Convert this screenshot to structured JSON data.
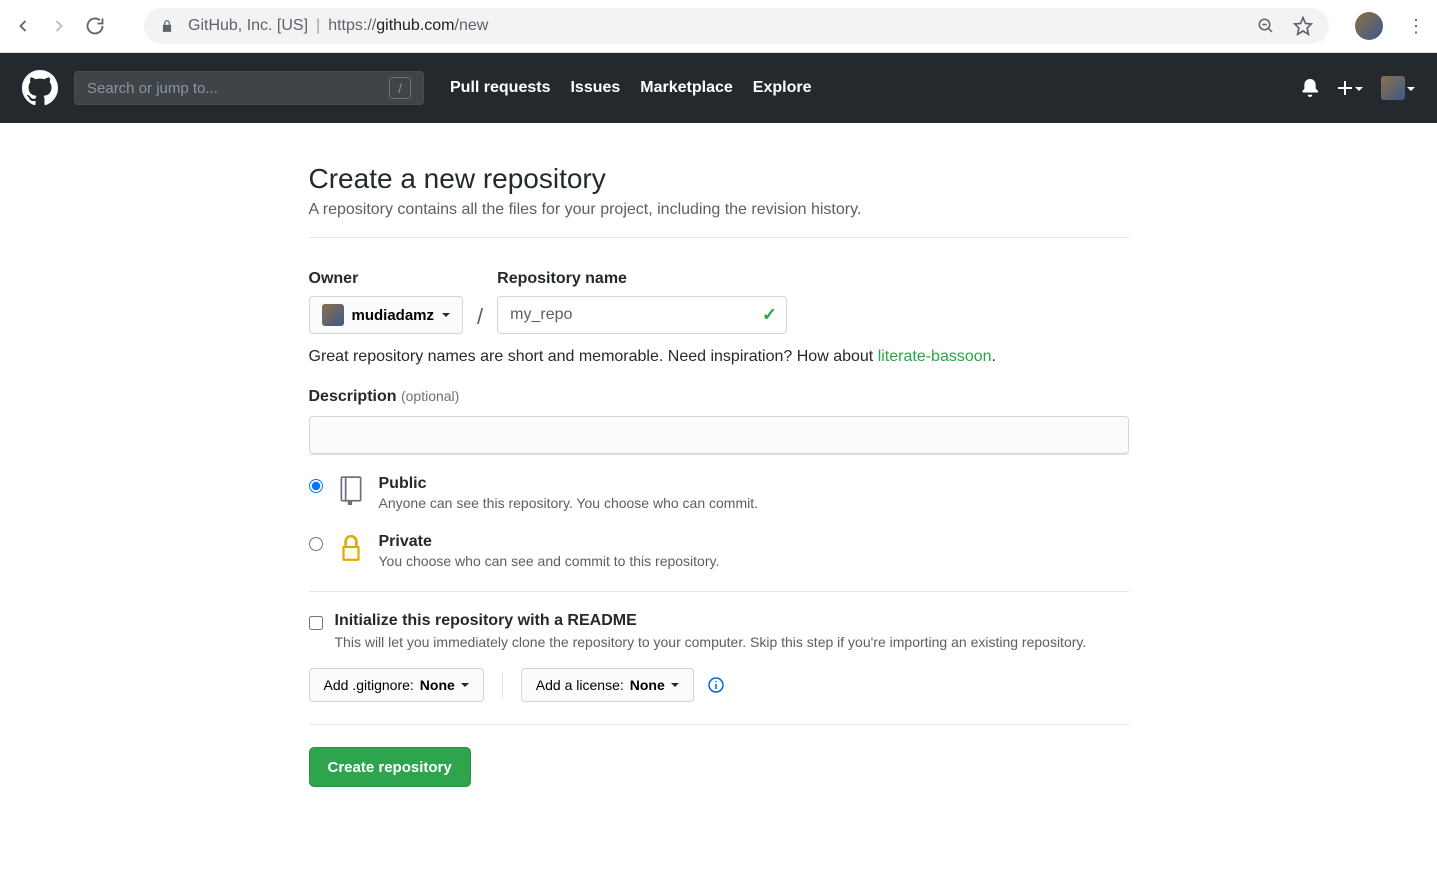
{
  "browser": {
    "identity": "GitHub, Inc. [US]",
    "url_protocol": "https://",
    "url_domain": "github.com",
    "url_path": "/new"
  },
  "gh_header": {
    "search_placeholder": "Search or jump to...",
    "slash_key": "/",
    "nav": [
      "Pull requests",
      "Issues",
      "Marketplace",
      "Explore"
    ]
  },
  "page": {
    "title": "Create a new repository",
    "subtitle": "A repository contains all the files for your project, including the revision history.",
    "owner_label": "Owner",
    "owner_value": "mudiadamz",
    "reponame_label": "Repository name",
    "reponame_value": "my_repo",
    "hint_prefix": "Great repository names are short and memorable. Need inspiration? How about ",
    "hint_suggestion": "literate-bassoon",
    "hint_suffix": ".",
    "description_label": "Description",
    "description_optional": "(optional)",
    "description_value": "",
    "visibility": {
      "public_title": "Public",
      "public_desc": "Anyone can see this repository. You choose who can commit.",
      "private_title": "Private",
      "private_desc": "You choose who can see and commit to this repository.",
      "selected": "public"
    },
    "init": {
      "title": "Initialize this repository with a README",
      "desc": "This will let you immediately clone the repository to your computer. Skip this step if you're importing an existing repository.",
      "checked": false
    },
    "gitignore": {
      "prefix": "Add .gitignore: ",
      "value": "None"
    },
    "license": {
      "prefix": "Add a license: ",
      "value": "None"
    },
    "submit": "Create repository"
  }
}
